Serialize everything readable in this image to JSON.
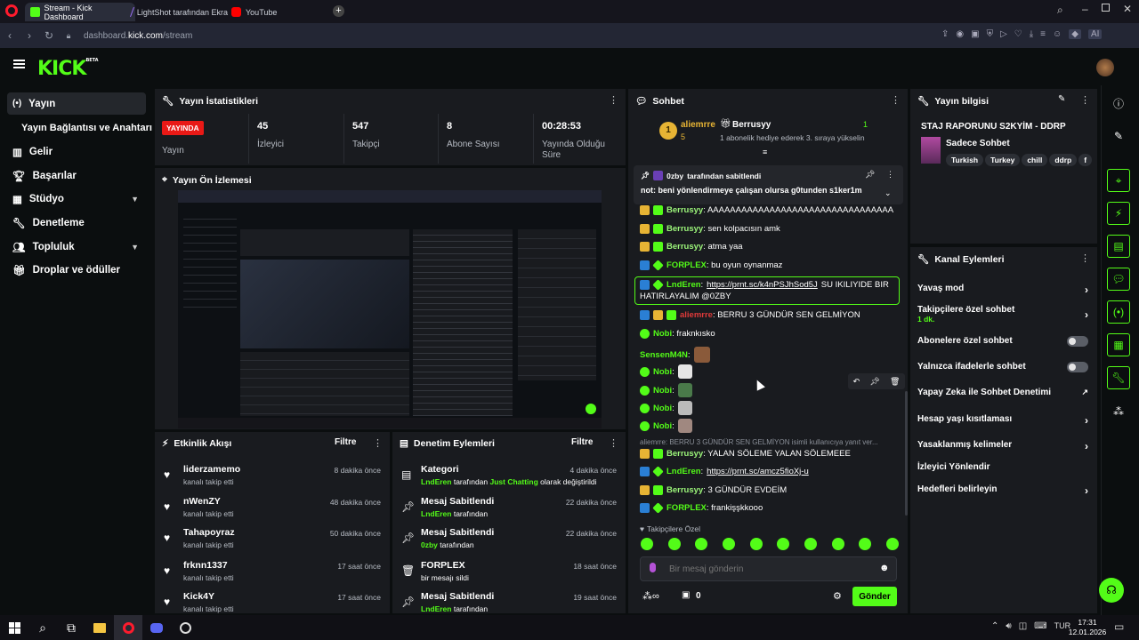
{
  "browser": {
    "tabs": [
      {
        "label": "Stream - Kick Dashboard",
        "color": "#53fc18"
      },
      {
        "label": "LightShot tarafından Ekra",
        "color": "#a070ff"
      },
      {
        "label": "YouTube",
        "color": "#ff0000"
      }
    ],
    "url_prefix": "dashboard.",
    "url_domain": "kick.com",
    "url_path": "/stream"
  },
  "kick": {
    "logo": "KICK",
    "logo_sup": "BETA"
  },
  "sidebar": {
    "items": [
      {
        "label": "Yayın",
        "icon": "broadcast-icon"
      },
      {
        "label": "Yayın Bağlantısı ve Anahtarı",
        "icon": ""
      },
      {
        "label": "Gelir",
        "icon": "chart-icon"
      },
      {
        "label": "Başarılar",
        "icon": "trophy-icon"
      },
      {
        "label": "Stüdyo",
        "icon": "studio-icon"
      },
      {
        "label": "Denetleme",
        "icon": "wrench-icon"
      },
      {
        "label": "Topluluk",
        "icon": "people-icon"
      },
      {
        "label": "Droplar ve ödüller",
        "icon": "gift-icon"
      }
    ]
  },
  "stats": {
    "title": "Yayın İstatistikleri",
    "live_badge": "YAYINDA",
    "live_label": "Yayın",
    "viewers": "45",
    "viewers_label": "İzleyici",
    "followers": "547",
    "followers_label": "Takipçi",
    "subs": "8",
    "subs_label": "Abone Sayısı",
    "duration": "00:28:53",
    "duration_label": "Yayında Olduğu Süre"
  },
  "preview": {
    "title": "Yayın Ön İzlemesi"
  },
  "activity": {
    "title": "Etkinlik Akışı",
    "filter": "Filtre",
    "items": [
      {
        "name": "liderzamemo",
        "sub": "kanalı takip etti",
        "time": "8 dakika önce"
      },
      {
        "name": "nWenZY",
        "sub": "kanalı takip etti",
        "time": "48 dakika önce"
      },
      {
        "name": "Tahapoyraz",
        "sub": "kanalı takip etti",
        "time": "50 dakika önce"
      },
      {
        "name": "frknn1337",
        "sub": "kanalı takip etti",
        "time": "17 saat önce"
      },
      {
        "name": "Kick4Y",
        "sub": "kanalı takip etti",
        "time": "17 saat önce"
      }
    ]
  },
  "modlog": {
    "title": "Denetim Eylemleri",
    "filter": "Filtre",
    "items": [
      {
        "name": "Kategori",
        "user": "LndEren",
        "mid": " tarafından ",
        "extra": "Just Chatting",
        "tail": " olarak değiştirildi",
        "time": "4 dakika önce"
      },
      {
        "name": "Mesaj Sabitlendi",
        "user": "LndEren",
        "mid": " tarafından",
        "extra": "",
        "tail": "",
        "time": "22 dakika önce"
      },
      {
        "name": "Mesaj Sabitlendi",
        "user": "0zby",
        "mid": " tarafından",
        "extra": "",
        "tail": "",
        "time": "22 dakika önce"
      },
      {
        "name": "FORPLEX",
        "user": "",
        "mid": "bir mesajı sildi",
        "extra": "",
        "tail": "",
        "time": "18 saat önce"
      },
      {
        "name": "Mesaj Sabitlendi",
        "user": "LndEren",
        "mid": " tarafından",
        "extra": "",
        "tail": "",
        "time": "19 saat önce"
      }
    ]
  },
  "chat": {
    "title": "Sohbet",
    "leader_rank": "1",
    "leader_name": "aliemrre",
    "leader_count": "5",
    "gifter_name": "Berrusyy",
    "gifter_count": "1",
    "gifter_note": "1 abonelik hediye ederek 3. sıraya yükselin",
    "pinned_by": "0zby",
    "pinned_by_suffix": " tarafından sabitlendi",
    "pinned_text": "not: beni yönlendirmeye çalışan olursa g0tunden s1ker1m",
    "messages": [
      {
        "user": "Berrusyy",
        "text": ": AAAAAAAAAAAAAAAAAAAAAAAAAAAAAAAAA"
      },
      {
        "user": "Berrusyy",
        "text": ": sen kolpacısın amk"
      },
      {
        "user": "Berrusyy",
        "text": ": atma yaa"
      },
      {
        "user": "FORPLEX",
        "text": ": bu oyun oynanmaz"
      },
      {
        "user": "LndEren",
        "link": "https://prnt.sc/k4nPSJhSod5J",
        "text": " SU IKILIYIDE BIR",
        "text2": "HATIRLAYALIM @0ZBY"
      },
      {
        "user": "aliemrre",
        "text": ": BERRU 3 GÜNDÜR SEN GELMİYON"
      },
      {
        "user": "Nobi",
        "text": ": fraknkısko"
      },
      {
        "user": "SensenM4N",
        "text": ":"
      },
      {
        "user": "Nobi",
        "text": ":"
      },
      {
        "user": "Nobi",
        "text": ":"
      },
      {
        "user": "Nobi",
        "text": ":"
      },
      {
        "user": "Nobi",
        "text": ":"
      },
      {
        "reply": "aliemrre: BERRU 3 GÜNDÜR SEN GELMİYON isimli kullanıcıya yanıt ver..."
      },
      {
        "user": "Berrusyy",
        "text": ": YALAN SÖLEME YALAN SÖLEMEEE"
      },
      {
        "user": "LndEren",
        "link": "https://prnt.sc/amcz5fioXj-u",
        "text": ""
      },
      {
        "user": "Berrusyy",
        "text": ": 3 GÜNDÜR EVDEİM"
      },
      {
        "user": "FORPLEX",
        "text": ": frankişşkkooo"
      }
    ],
    "follower_only_label": "Takipçilere Özel",
    "input_placeholder": "Bir mesaj gönderin",
    "points_count": "0",
    "send_label": "Gönder"
  },
  "streaminfo": {
    "title": "Yayın bilgisi",
    "stream_title": "STAJ RAPORUNU S2KYİM - DDRP",
    "category": "Sadece Sohbet",
    "tags": [
      "Turkish",
      "Turkey",
      "chill",
      "ddrp",
      "f"
    ]
  },
  "channel_actions": {
    "title": "Kanal Eylemleri",
    "items": [
      {
        "label": "Yavaş mod",
        "type": "arrow"
      },
      {
        "label": "Takipçilere özel sohbet",
        "sub": "1 dk.",
        "type": "arrow"
      },
      {
        "label": "Abonelere özel sohbet",
        "type": "toggle"
      },
      {
        "label": "Yalnızca ifadelerle sohbet",
        "type": "toggle"
      },
      {
        "label": "Yapay Zeka ile Sohbet Denetimi",
        "type": "external"
      },
      {
        "label": "Hesap yaşı kısıtlaması",
        "type": "arrow"
      },
      {
        "label": "Yasaklanmış kelimeler",
        "type": "arrow"
      },
      {
        "label": "İzleyici Yönlendir",
        "type": "none"
      },
      {
        "label": "Hedefleri belirleyin",
        "type": "arrow"
      }
    ]
  },
  "taskbar": {
    "lang": "TUR",
    "time": "17:31",
    "date": "12.01.2026"
  },
  "colors": {
    "accent": "#53fc18",
    "panel": "#191b1f",
    "bg": "#0b0e0f"
  }
}
